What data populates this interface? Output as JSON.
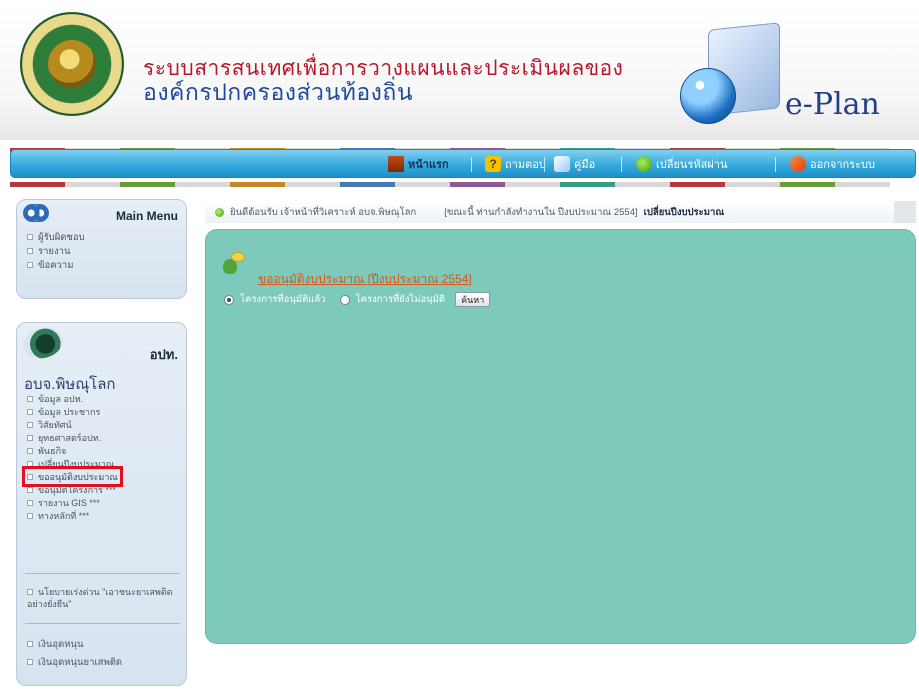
{
  "header": {
    "title_line1": "ระบบสารสนเทศเพื่อการวางแผนและประเมินผลของ",
    "title_line2": "องค์กรปกครองส่วนท้องถิ่น",
    "logo_text": "e-Plan"
  },
  "nav": {
    "home": "หน้าแรก",
    "faq": "ถามตอบ",
    "manual": "คู่มือ",
    "change_password": "เปลี่ยนรหัสผ่าน",
    "logout": "ออกจากระบบ"
  },
  "sidebar": {
    "main_menu": {
      "title": "Main Menu",
      "items": [
        "ผู้รับผิดชอบ",
        "รายงาน",
        "ข้อความ"
      ]
    },
    "org": {
      "abbr": "อปท.",
      "name": "อบจ.พิษณุโลก",
      "items": [
        "ข้อมูล อปท.",
        "ข้อมูล ประชากร",
        "วิสัยทัศน์",
        "ยุทธศาสตร์อปท.",
        "พันธกิจ",
        "เปลี่ยนปีงบประมาณ",
        "ขออนุมัติงบประมาณ",
        "ขอนุมัติโครงการ ***",
        "รายงาน GIS ***",
        "ทางหลักที่ ***"
      ],
      "highlighted_index": 6,
      "policy_link": "นโยบายเร่งด่วน \"เอาชนะยาเสพติดอย่างยั่งยืน\"",
      "budget_items": [
        "เงินอุดหนุน",
        "เงินอุดหนุนยาเสพติด"
      ]
    }
  },
  "infobar": {
    "welcome": "ยินดีต้อนรับ เจ้าหน้าที่วิเคราะห์ อบจ.พิษณุโลก",
    "today": "[ขณะนี้ ท่านกำลังทำงานใน ปีงบประมาณ 2554]",
    "change_year": "เปลี่ยนปีงบประมาณ"
  },
  "content": {
    "section_title": "ขออนุมัติงบประมาณ [ปีงบประมาณ 2554]",
    "radio_options": [
      "โครงการที่อนุมัติแล้ว",
      "โครงการที่ยังไม่อนุมัติ"
    ],
    "selected_radio": 0,
    "search_button": "ค้นหา"
  },
  "colors": {
    "nav_blue": "#31a7dc",
    "content_teal": "#7dcabb",
    "title_red": "#b7172a",
    "title_blue": "#1d4aa0",
    "highlight_red": "#e0101e",
    "section_orange": "#d2581b"
  },
  "icons": {
    "home": "house-icon",
    "faq": "question-icon",
    "manual": "book-icon",
    "password": "key-icon",
    "logout": "exit-icon"
  }
}
